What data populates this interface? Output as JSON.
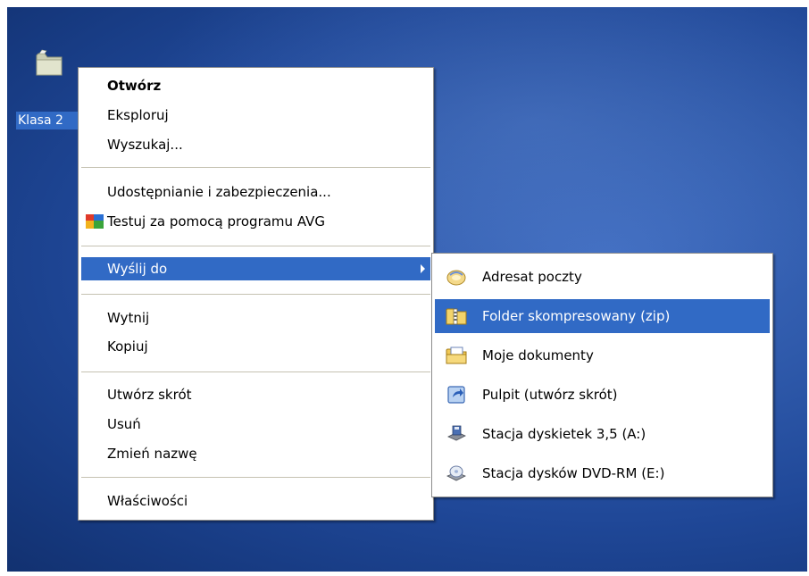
{
  "desktop": {
    "icon_label": "Klasa 2"
  },
  "context_menu": {
    "items": [
      {
        "label": "Otwórz"
      },
      {
        "label": "Eksploruj"
      },
      {
        "label": "Wyszukaj..."
      },
      {
        "label": "Udostępnianie i zabezpieczenia..."
      },
      {
        "label": "Testuj za pomocą programu AVG"
      },
      {
        "label": "Wyślij do"
      },
      {
        "label": "Wytnij"
      },
      {
        "label": "Kopiuj"
      },
      {
        "label": "Utwórz skrót"
      },
      {
        "label": "Usuń"
      },
      {
        "label": "Zmień nazwę"
      },
      {
        "label": "Właściwości"
      }
    ]
  },
  "send_to_menu": {
    "items": [
      {
        "label": "Adresat poczty",
        "icon": "mail-recipient-icon"
      },
      {
        "label": "Folder skompresowany (zip)",
        "icon": "zip-folder-icon"
      },
      {
        "label": "Moje dokumenty",
        "icon": "my-documents-icon"
      },
      {
        "label": "Pulpit (utwórz skrót)",
        "icon": "desktop-shortcut-icon"
      },
      {
        "label": "Stacja dyskietek 3,5 (A:)",
        "icon": "floppy-drive-icon"
      },
      {
        "label": "Stacja dysków DVD-RM (E:)",
        "icon": "dvd-drive-icon"
      }
    ]
  },
  "colors": {
    "highlight": "#316ac5",
    "desktop_blue": "#2f5aab"
  }
}
